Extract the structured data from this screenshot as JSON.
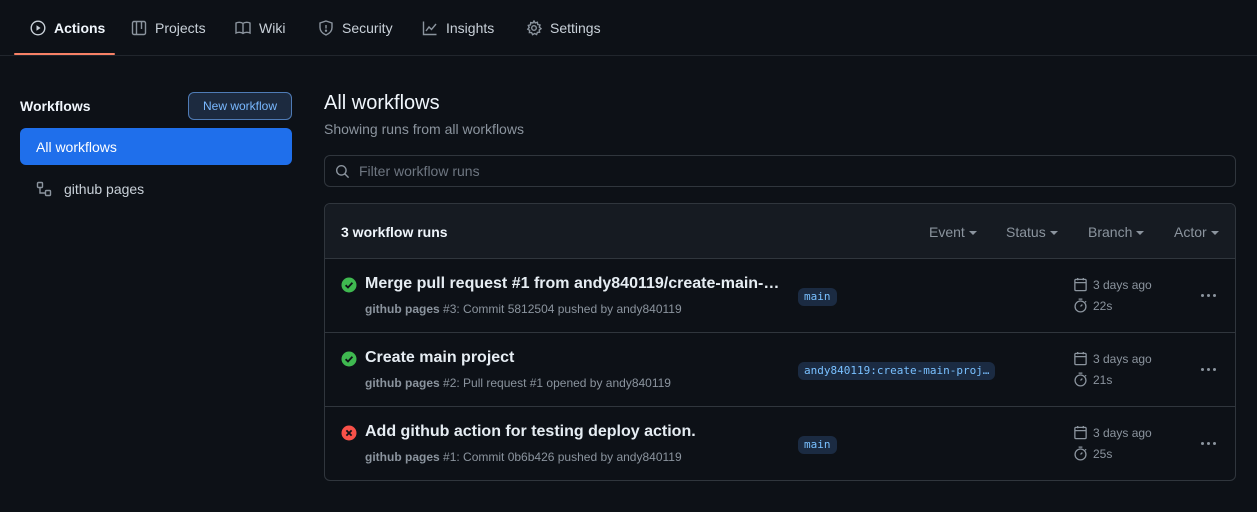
{
  "nav": {
    "tabs": [
      {
        "label": "Actions",
        "icon": "play-circle-icon",
        "active": true
      },
      {
        "label": "Projects",
        "icon": "table-icon"
      },
      {
        "label": "Wiki",
        "icon": "book-icon"
      },
      {
        "label": "Security",
        "icon": "shield-icon"
      },
      {
        "label": "Insights",
        "icon": "graph-icon"
      },
      {
        "label": "Settings",
        "icon": "gear-icon"
      }
    ]
  },
  "sidebar": {
    "title": "Workflows",
    "new_workflow_label": "New workflow",
    "items": [
      {
        "label": "All workflows",
        "active": true
      },
      {
        "label": "github pages",
        "icon": "workflow-icon"
      }
    ]
  },
  "main": {
    "title": "All workflows",
    "subtitle": "Showing runs from all workflows",
    "filter_placeholder": "Filter workflow runs",
    "runs_count": "3 workflow runs",
    "header_filters": [
      "Event",
      "Status",
      "Branch",
      "Actor"
    ],
    "runs": [
      {
        "status": "success",
        "title": "Merge pull request #1 from andy840119/create-main-pr...",
        "workflow": "github pages",
        "meta": "#3: Commit 5812504 pushed by andy840119",
        "branch": "main",
        "when": "3 days ago",
        "duration": "22s"
      },
      {
        "status": "success",
        "title": "Create main project",
        "workflow": "github pages",
        "meta": "#2: Pull request #1 opened by andy840119",
        "branch": "andy840119:create-main-proj…",
        "when": "3 days ago",
        "duration": "21s"
      },
      {
        "status": "failure",
        "title": "Add github action for testing deploy action.",
        "workflow": "github pages",
        "meta": "#1: Commit 0b6b426 pushed by andy840119",
        "branch": "main",
        "when": "3 days ago",
        "duration": "25s"
      }
    ]
  },
  "colors": {
    "background": "#0d1117",
    "accent": "#1f6feb",
    "tab_underline": "#f78166",
    "success": "#3fb950",
    "failure": "#f85149"
  }
}
